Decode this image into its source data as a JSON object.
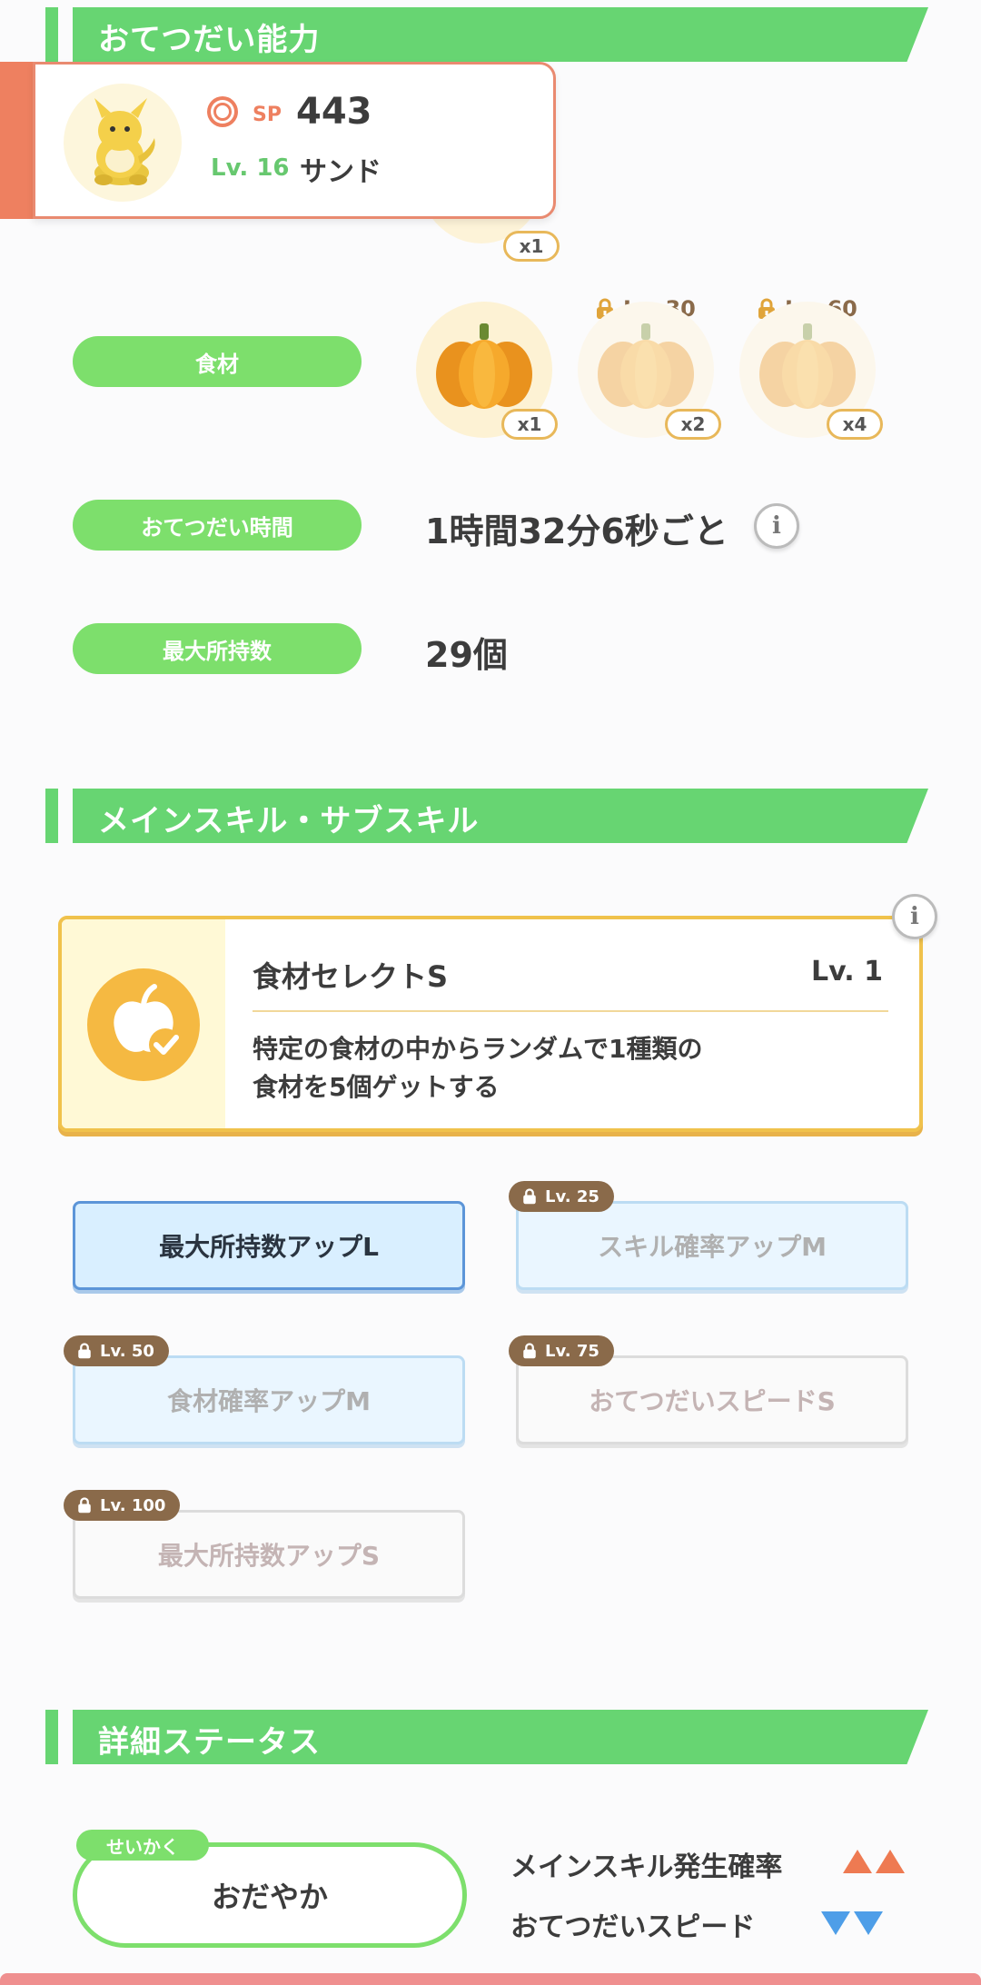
{
  "sections": {
    "helping": "おてつだい能力",
    "skills": "メインスキル・サブスキル",
    "details": "詳細ステータス"
  },
  "pokemon": {
    "sp_label": "SP",
    "sp_value": "443",
    "level": "Lv. 16",
    "name": "サンド"
  },
  "ingredients": {
    "label": "食材",
    "hidden_qty": "x1",
    "items": [
      {
        "icon": "pumpkin-icon",
        "qty": "x1",
        "lock": ""
      },
      {
        "icon": "pumpkin-icon",
        "qty": "x2",
        "lock": "Lv. 30"
      },
      {
        "icon": "pumpkin-icon",
        "qty": "x4",
        "lock": "Lv. 60"
      }
    ]
  },
  "help_time": {
    "label": "おてつだい時間",
    "value": "1時間32分6秒ごと"
  },
  "max_carry": {
    "label": "最大所持数",
    "value": "29個"
  },
  "main_skill": {
    "name": "食材セレクトS",
    "level": "Lv. 1",
    "desc_line1": "特定の食材の中からランダムで1種類の",
    "desc_line2": "食材を5個ゲットする"
  },
  "sub_skills": [
    {
      "name": "最大所持数アップL",
      "lock": "",
      "state": "active"
    },
    {
      "name": "スキル確率アップM",
      "lock": "Lv. 25",
      "state": "blue-locked"
    },
    {
      "name": "食材確率アップM",
      "lock": "Lv. 50",
      "state": "blue-locked"
    },
    {
      "name": "おてつだいスピードS",
      "lock": "Lv. 75",
      "state": "grey-locked"
    },
    {
      "name": "最大所持数アップS",
      "lock": "Lv. 100",
      "state": "grey-locked"
    }
  ],
  "nature": {
    "tag": "せいかく",
    "name": "おだやか",
    "up_effect": "メインスキル発生確率",
    "down_effect": "おてつだいスピード"
  },
  "colors": {
    "green": "#67d572",
    "pill_green": "#7ddf6c",
    "accent_orange": "#ee8060",
    "up_arrow": "#ee7a52",
    "down_arrow": "#4e9ee8",
    "lock_brown": "#8a6a4a"
  }
}
